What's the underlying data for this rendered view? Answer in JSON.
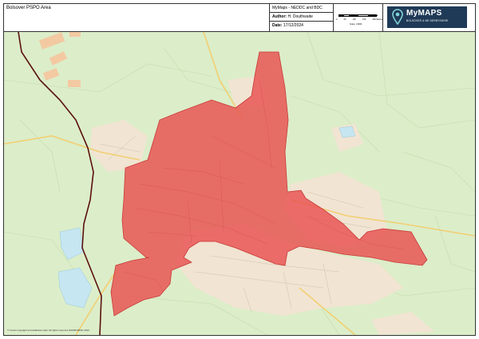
{
  "header": {
    "title": "Bolsover PSPO Area",
    "project": "MyMaps - NEDDC and BDC",
    "author_label": "Author:",
    "author": "H. Douthwaite",
    "date_label": "Date:",
    "date": "17/12/2024"
  },
  "scale": {
    "ticks": [
      "0",
      "50",
      "100",
      "150",
      "200 Metres"
    ],
    "text": "Scale: 1:9000"
  },
  "logo": {
    "name": "MyMAPS",
    "subtitle": "BOLSOVER & NE DERBYSHIRE",
    "icon": "map-pin-icon",
    "background": "#1f3a57"
  },
  "map": {
    "copyright": "© Crown copyright and database right. All rights reserved (0100019531) 2024",
    "colors": {
      "fields": "#d9ecc5",
      "urban": "#f1e6d6",
      "pspo_area": "#e8504f",
      "boundary": "#5a1010",
      "water": "#bfe3ef",
      "roads": "#f6d98a"
    }
  }
}
